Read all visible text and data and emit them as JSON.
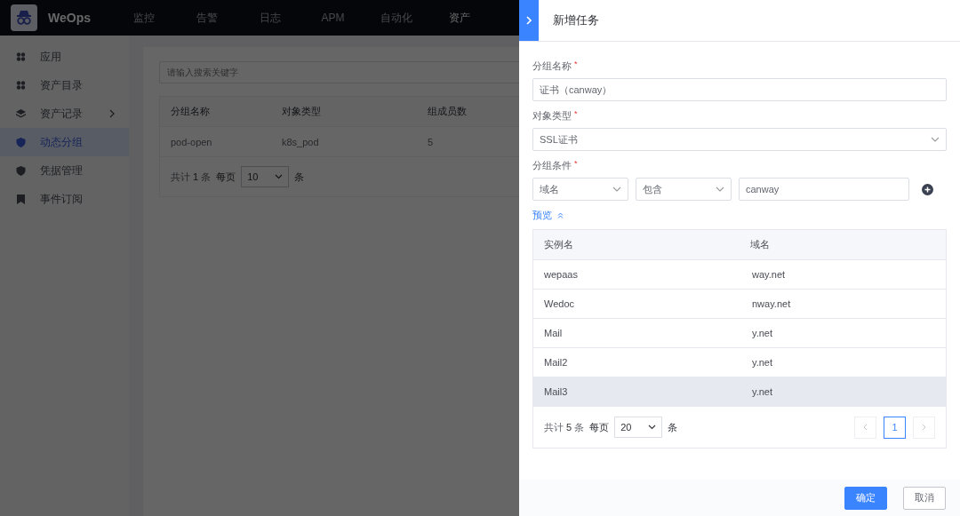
{
  "app": {
    "logo_text": "WeOps"
  },
  "top_nav": [
    {
      "label": "监控",
      "selected": false
    },
    {
      "label": "告警",
      "selected": false
    },
    {
      "label": "日志",
      "selected": false
    },
    {
      "label": "APM",
      "selected": false
    },
    {
      "label": "自动化",
      "selected": false
    },
    {
      "label": "资产",
      "selected": true
    }
  ],
  "sidebar": {
    "items": [
      {
        "label": "应用",
        "kind": "grid",
        "selected": false,
        "expandable": false
      },
      {
        "label": "资产目录",
        "kind": "grid",
        "selected": false,
        "expandable": false
      },
      {
        "label": "资产记录",
        "kind": "layers",
        "selected": false,
        "expandable": true
      },
      {
        "label": "动态分组",
        "kind": "shield",
        "selected": true,
        "expandable": false
      },
      {
        "label": "凭据管理",
        "kind": "shield",
        "selected": false,
        "expandable": false
      },
      {
        "label": "事件订阅",
        "kind": "bookmark",
        "selected": false,
        "expandable": false
      }
    ]
  },
  "main": {
    "search": {
      "placeholder": "请输入搜索关键字"
    },
    "table": {
      "columns": [
        "分组名称",
        "对象类型",
        "组成员数"
      ],
      "rows": [
        [
          "pod-open",
          "k8s_pod",
          "5"
        ]
      ]
    },
    "pagination": {
      "total_prefix": "共计",
      "total": "1",
      "total_suffix": "条",
      "per_page_label": "每页",
      "per_page": "10",
      "unit": "条"
    }
  },
  "drawer": {
    "title": "新增任务",
    "fields": [
      {
        "kind": "input",
        "label": "分组名称",
        "required_mark": "*",
        "value": "证书（canway）"
      },
      {
        "kind": "select",
        "label": "对象类型",
        "required_mark": "*",
        "value": "SSL证书"
      },
      {
        "kind": "condition",
        "label": "分组条件",
        "required_mark": "*",
        "field": "域名",
        "operator": "包含",
        "value": "canway"
      }
    ],
    "preview_link": "预览",
    "preview_table": {
      "columns": [
        "实例名",
        "域名"
      ],
      "rows": [
        {
          "cells": [
            "wepaas",
            "way.net"
          ],
          "highlighted": false
        },
        {
          "cells": [
            "Wedoc",
            "nway.net"
          ],
          "highlighted": false
        },
        {
          "cells": [
            "Mail",
            "y.net"
          ],
          "highlighted": false
        },
        {
          "cells": [
            "Mail2",
            "y.net"
          ],
          "highlighted": false
        },
        {
          "cells": [
            "Mail3",
            "y.net"
          ],
          "highlighted": true
        }
      ]
    },
    "pagination": {
      "total_prefix": "共计",
      "total": "5",
      "total_suffix": "条",
      "per_page_label": "每页",
      "per_page": "20",
      "unit": "条",
      "pages": [
        {
          "label": "1",
          "selected": true
        }
      ],
      "prev_disabled": true,
      "next_disabled": true
    },
    "buttons": [
      {
        "kind": "primary",
        "label": "确定"
      },
      {
        "kind": "default",
        "label": "取消"
      }
    ]
  }
}
